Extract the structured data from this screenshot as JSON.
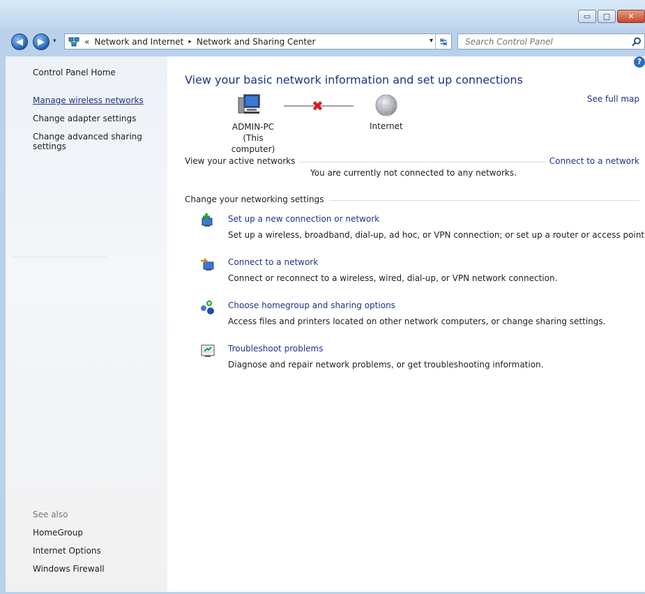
{
  "window": {
    "minimize_label": "▭",
    "maximize_label": "□",
    "close_label": "✕"
  },
  "address_bar": {
    "breadcrumb_root": "«",
    "crumb_1": "Network and Internet",
    "crumb_2": "Network and Sharing Center",
    "separator": "▸"
  },
  "search": {
    "placeholder": "Search Control Panel"
  },
  "left_pane": {
    "home": "Control Panel Home",
    "manage_wireless": "Manage wireless networks",
    "change_adapter": "Change adapter settings",
    "change_sharing_line1": "Change advanced sharing",
    "change_sharing_line2": "settings",
    "see_also": "See also",
    "homegroup": "HomeGroup",
    "internet_options": "Internet Options",
    "windows_firewall": "Windows Firewall"
  },
  "main": {
    "heading": "View your basic network information and set up connections",
    "see_full_map": "See full map",
    "computer_name": "ADMIN-PC",
    "computer_sub": "(This computer)",
    "internet_label": "Internet",
    "active_networks_label": "View your active networks",
    "connect_link": "Connect to a network",
    "not_connected": "You are currently not connected to any networks.",
    "change_settings_label": "Change your networking settings",
    "help_label": "?",
    "tasks": [
      {
        "title": "Set up a new connection or network",
        "desc": "Set up a wireless, broadband, dial-up, ad hoc, or VPN connection; or set up a router or access point."
      },
      {
        "title": "Connect to a network",
        "desc": "Connect or reconnect to a wireless, wired, dial-up, or VPN network connection."
      },
      {
        "title": "Choose homegroup and sharing options",
        "desc": "Access files and printers located on other network computers, or change sharing settings."
      },
      {
        "title": "Troubleshoot problems",
        "desc": "Diagnose and repair network problems, or get troubleshooting information."
      }
    ]
  },
  "colors": {
    "link": "#1e3287",
    "disconnected": "#d31f1f",
    "frame": "#b9d1ea"
  }
}
